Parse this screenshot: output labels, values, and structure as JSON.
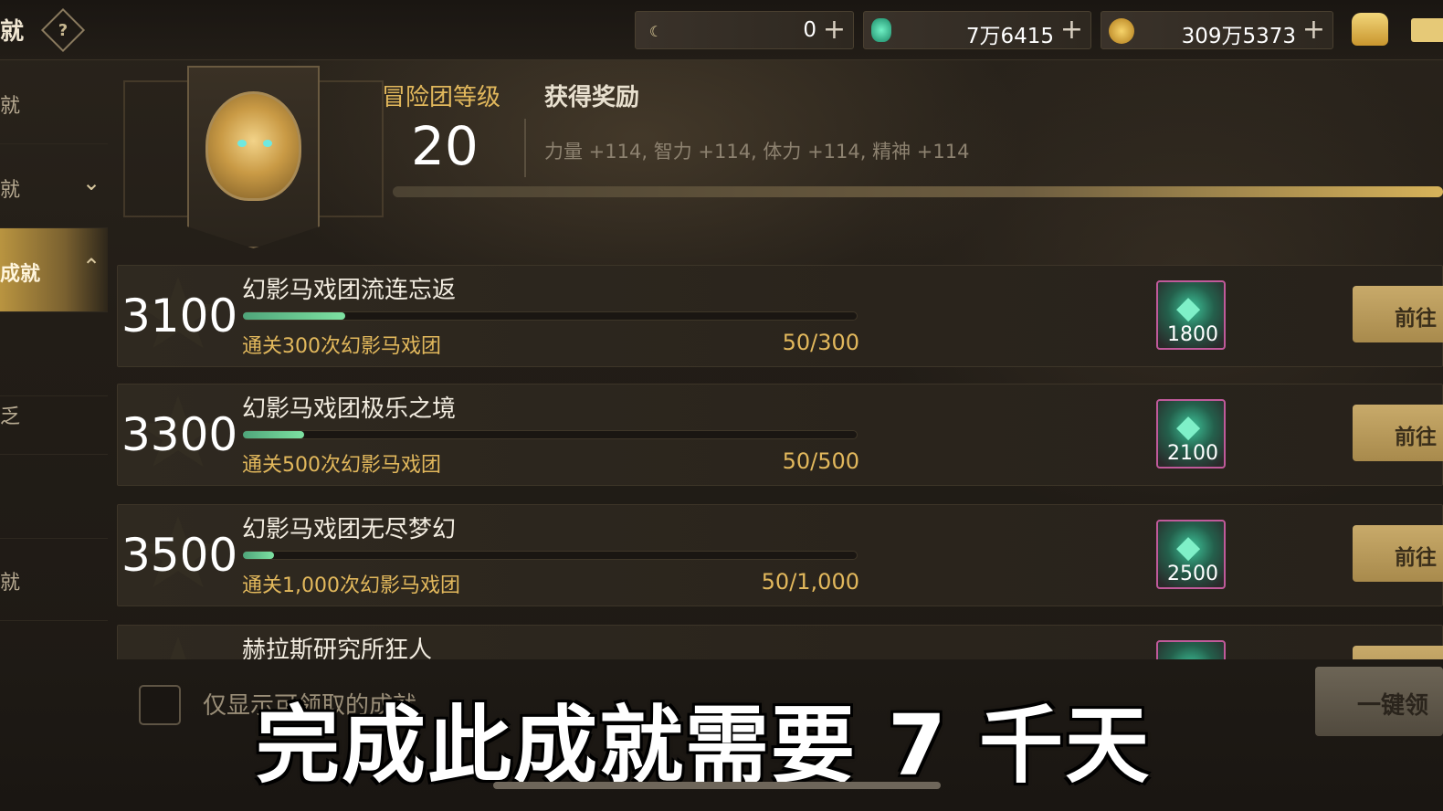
{
  "header": {
    "title": "就",
    "help_glyph": "?",
    "currencies": [
      {
        "icon": "crescent-coin-icon",
        "value": "0",
        "plus": "+"
      },
      {
        "icon": "green-gem-icon",
        "value": "7万6415",
        "plus": "+"
      },
      {
        "icon": "gold-coin-icon",
        "value": "309万5373",
        "plus": "+"
      }
    ]
  },
  "sidebar": {
    "items": [
      {
        "label": "就"
      },
      {
        "label": "就",
        "chevron": "⌄"
      },
      {
        "label": "成就",
        "chevron": "⌃"
      },
      {
        "label": ""
      },
      {
        "label": "乏"
      },
      {
        "label": ""
      },
      {
        "label": "就"
      }
    ]
  },
  "level": {
    "title": "冒险团等级",
    "value": "20",
    "reward_title": "获得奖励",
    "reward_text": "力量 +114, 智力 +114, 体力 +114, 精神 +114",
    "progress": 1.0
  },
  "achievements": [
    {
      "points": "3100",
      "name": "幻影马戏团流连忘返",
      "condition": "通关300次幻影马戏团",
      "count": "50/300",
      "progress": 0.1667,
      "reward_qty": "1800",
      "go_label": "前往"
    },
    {
      "points": "3300",
      "name": "幻影马戏团极乐之境",
      "condition": "通关500次幻影马戏团",
      "count": "50/500",
      "progress": 0.1,
      "reward_qty": "2100",
      "go_label": "前往"
    },
    {
      "points": "3500",
      "name": "幻影马戏团无尽梦幻",
      "condition": "通关1,000次幻影马戏团",
      "count": "50/1,000",
      "progress": 0.05,
      "reward_qty": "2500",
      "go_label": "前往"
    },
    {
      "points": "",
      "name": "赫拉斯研究所狂人",
      "condition": "",
      "count": "",
      "progress": 0,
      "reward_qty": "",
      "go_label": ""
    }
  ],
  "footer": {
    "checkbox_label": "仅显示可领取的成就",
    "claim_all_label": "一键领"
  },
  "subtitle": "完成此成就需要 7 千天",
  "colors": {
    "accent_gold": "#e2b85c",
    "progress_green": "#7de2a2",
    "reward_frame": "#c05a9a"
  }
}
